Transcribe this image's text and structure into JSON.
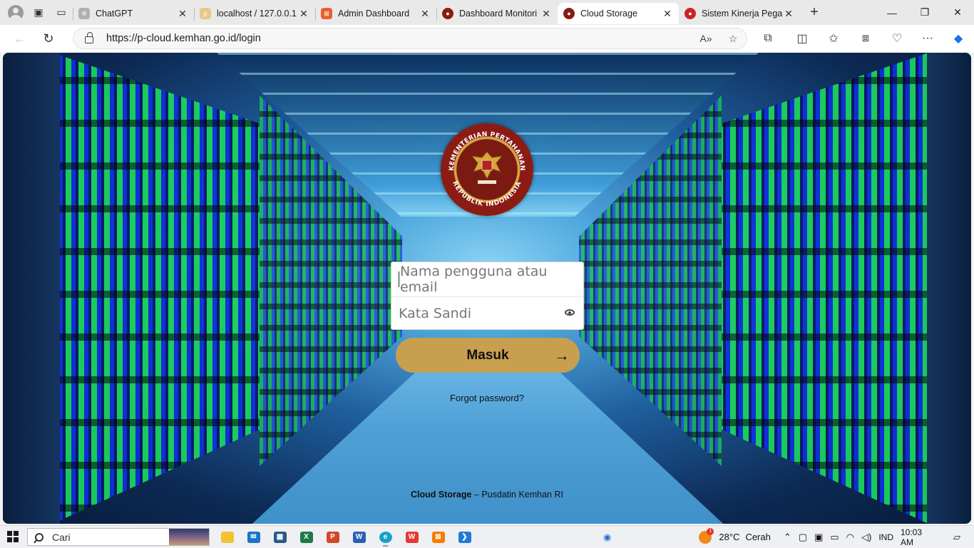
{
  "browser": {
    "tabs": [
      {
        "label": "ChatGPT",
        "favicon_color": "#b0b0b0",
        "active": false
      },
      {
        "label": "localhost / 127.0.0.1",
        "favicon_color": "#e8c88a",
        "active": false
      },
      {
        "label": "Admin Dashboard",
        "favicon_color": "#e9602c",
        "active": false
      },
      {
        "label": "Dashboard Monitori",
        "favicon_color": "#8a1c14",
        "active": false
      },
      {
        "label": "Cloud Storage",
        "favicon_color": "#8a1c14",
        "active": true
      },
      {
        "label": "Sistem Kinerja Pega",
        "favicon_color": "#cc2222",
        "active": false
      }
    ],
    "url": "https://p-cloud.kemhan.go.id/login"
  },
  "login": {
    "emblem_top_text": "KEMENTERIAN PERTAHANAN",
    "emblem_bottom_text": "REPUBLIK INDONESIA",
    "username_placeholder": "Nama pengguna atau email",
    "password_placeholder": "Kata Sandi",
    "submit_label": "Masuk",
    "forgot_label": "Forgot password?",
    "footer_brand": "Cloud Storage",
    "footer_rest": " – Pusdatin Kemhan RI",
    "accent_color": "#c89f4f"
  },
  "taskbar": {
    "search_placeholder": "Cari",
    "weather_temp": "28°C",
    "weather_desc": "Cerah",
    "weather_badge": "1",
    "language": "IND",
    "time": "10:03 AM"
  }
}
